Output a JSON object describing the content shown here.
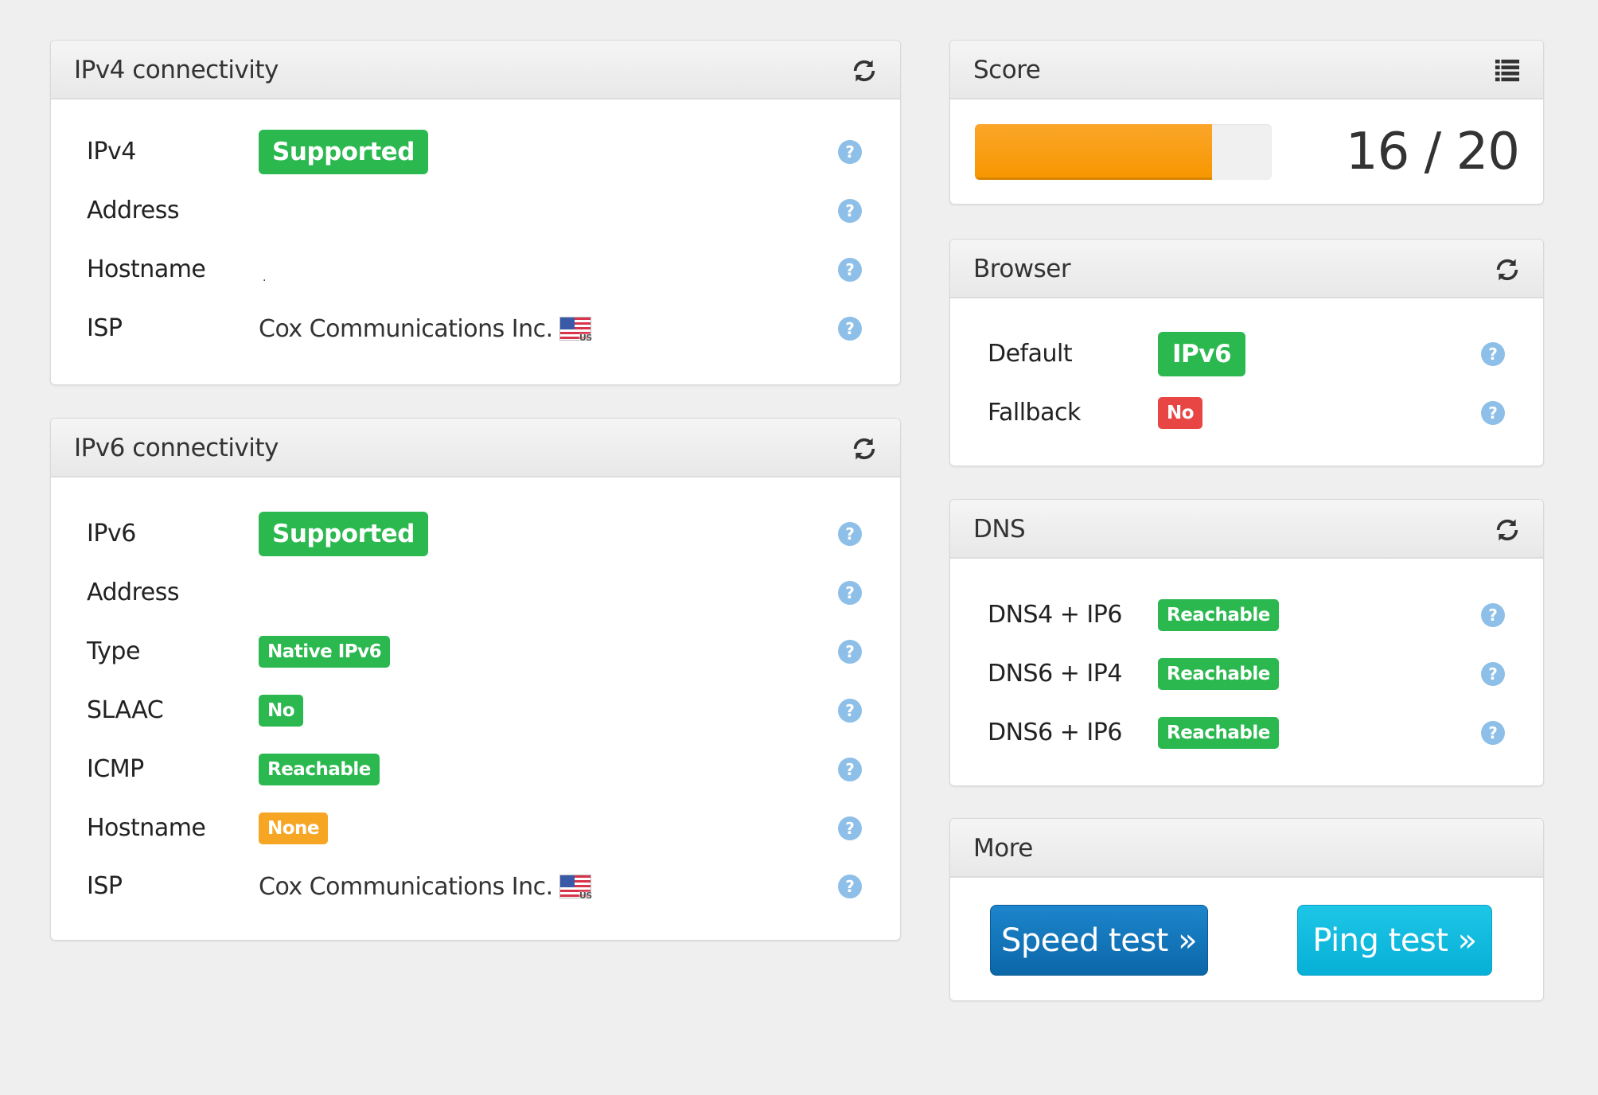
{
  "ipv4": {
    "title": "IPv4 connectivity",
    "refresh_icon": "refresh-icon",
    "rows": [
      {
        "label": "IPv4",
        "value": "Supported",
        "badge": "green"
      },
      {
        "label": "Address",
        "value": ""
      },
      {
        "label": "Hostname",
        "value": "."
      },
      {
        "label": "ISP",
        "value": "Cox Communications Inc.",
        "flag": "US"
      }
    ]
  },
  "ipv6": {
    "title": "IPv6 connectivity",
    "refresh_icon": "refresh-icon",
    "rows": [
      {
        "label": "IPv6",
        "value": "Supported",
        "badge": "green"
      },
      {
        "label": "Address",
        "value": ""
      },
      {
        "label": "Type",
        "value": "Native IPv6",
        "badge": "green"
      },
      {
        "label": "SLAAC",
        "value": "No",
        "badge": "green"
      },
      {
        "label": "ICMP",
        "value": "Reachable",
        "badge": "green"
      },
      {
        "label": "Hostname",
        "value": "None",
        "badge": "orange"
      },
      {
        "label": "ISP",
        "value": "Cox Communications Inc.",
        "flag": "US"
      }
    ]
  },
  "score": {
    "title": "Score",
    "list_icon": "list-icon",
    "value": 16,
    "max": 20,
    "text": "16 / 20"
  },
  "browser": {
    "title": "Browser",
    "rows": [
      {
        "label": "Default",
        "value": "IPv6",
        "badge": "green"
      },
      {
        "label": "Fallback",
        "value": "No",
        "badge": "red"
      }
    ]
  },
  "dns": {
    "title": "DNS",
    "rows": [
      {
        "label": "DNS4 + IP6",
        "value": "Reachable",
        "badge": "green"
      },
      {
        "label": "DNS6 + IP4",
        "value": "Reachable",
        "badge": "green"
      },
      {
        "label": "DNS6 + IP6",
        "value": "Reachable",
        "badge": "green"
      }
    ]
  },
  "more": {
    "title": "More",
    "speed_test": "Speed test »",
    "ping_test": "Ping test »"
  },
  "help_glyph": "?",
  "colors": {
    "green": "#2ab84f",
    "red": "#e84545",
    "orange": "#f6a623",
    "help": "#8dbfe8",
    "progress": "#f79700"
  }
}
